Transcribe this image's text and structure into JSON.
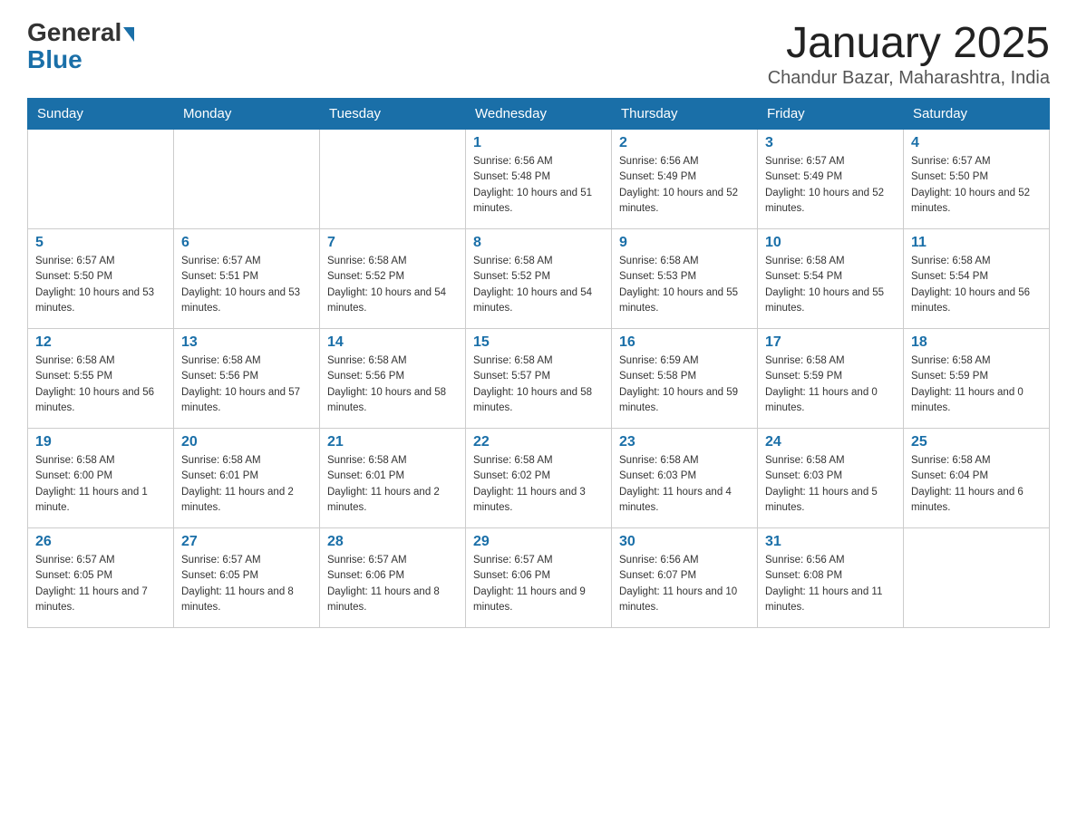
{
  "header": {
    "logo_general": "General",
    "logo_blue": "Blue",
    "month_year": "January 2025",
    "location": "Chandur Bazar, Maharashtra, India"
  },
  "weekdays": [
    "Sunday",
    "Monday",
    "Tuesday",
    "Wednesday",
    "Thursday",
    "Friday",
    "Saturday"
  ],
  "weeks": [
    [
      {
        "day": "",
        "info": ""
      },
      {
        "day": "",
        "info": ""
      },
      {
        "day": "",
        "info": ""
      },
      {
        "day": "1",
        "info": "Sunrise: 6:56 AM\nSunset: 5:48 PM\nDaylight: 10 hours and 51 minutes."
      },
      {
        "day": "2",
        "info": "Sunrise: 6:56 AM\nSunset: 5:49 PM\nDaylight: 10 hours and 52 minutes."
      },
      {
        "day": "3",
        "info": "Sunrise: 6:57 AM\nSunset: 5:49 PM\nDaylight: 10 hours and 52 minutes."
      },
      {
        "day": "4",
        "info": "Sunrise: 6:57 AM\nSunset: 5:50 PM\nDaylight: 10 hours and 52 minutes."
      }
    ],
    [
      {
        "day": "5",
        "info": "Sunrise: 6:57 AM\nSunset: 5:50 PM\nDaylight: 10 hours and 53 minutes."
      },
      {
        "day": "6",
        "info": "Sunrise: 6:57 AM\nSunset: 5:51 PM\nDaylight: 10 hours and 53 minutes."
      },
      {
        "day": "7",
        "info": "Sunrise: 6:58 AM\nSunset: 5:52 PM\nDaylight: 10 hours and 54 minutes."
      },
      {
        "day": "8",
        "info": "Sunrise: 6:58 AM\nSunset: 5:52 PM\nDaylight: 10 hours and 54 minutes."
      },
      {
        "day": "9",
        "info": "Sunrise: 6:58 AM\nSunset: 5:53 PM\nDaylight: 10 hours and 55 minutes."
      },
      {
        "day": "10",
        "info": "Sunrise: 6:58 AM\nSunset: 5:54 PM\nDaylight: 10 hours and 55 minutes."
      },
      {
        "day": "11",
        "info": "Sunrise: 6:58 AM\nSunset: 5:54 PM\nDaylight: 10 hours and 56 minutes."
      }
    ],
    [
      {
        "day": "12",
        "info": "Sunrise: 6:58 AM\nSunset: 5:55 PM\nDaylight: 10 hours and 56 minutes."
      },
      {
        "day": "13",
        "info": "Sunrise: 6:58 AM\nSunset: 5:56 PM\nDaylight: 10 hours and 57 minutes."
      },
      {
        "day": "14",
        "info": "Sunrise: 6:58 AM\nSunset: 5:56 PM\nDaylight: 10 hours and 58 minutes."
      },
      {
        "day": "15",
        "info": "Sunrise: 6:58 AM\nSunset: 5:57 PM\nDaylight: 10 hours and 58 minutes."
      },
      {
        "day": "16",
        "info": "Sunrise: 6:59 AM\nSunset: 5:58 PM\nDaylight: 10 hours and 59 minutes."
      },
      {
        "day": "17",
        "info": "Sunrise: 6:58 AM\nSunset: 5:59 PM\nDaylight: 11 hours and 0 minutes."
      },
      {
        "day": "18",
        "info": "Sunrise: 6:58 AM\nSunset: 5:59 PM\nDaylight: 11 hours and 0 minutes."
      }
    ],
    [
      {
        "day": "19",
        "info": "Sunrise: 6:58 AM\nSunset: 6:00 PM\nDaylight: 11 hours and 1 minute."
      },
      {
        "day": "20",
        "info": "Sunrise: 6:58 AM\nSunset: 6:01 PM\nDaylight: 11 hours and 2 minutes."
      },
      {
        "day": "21",
        "info": "Sunrise: 6:58 AM\nSunset: 6:01 PM\nDaylight: 11 hours and 2 minutes."
      },
      {
        "day": "22",
        "info": "Sunrise: 6:58 AM\nSunset: 6:02 PM\nDaylight: 11 hours and 3 minutes."
      },
      {
        "day": "23",
        "info": "Sunrise: 6:58 AM\nSunset: 6:03 PM\nDaylight: 11 hours and 4 minutes."
      },
      {
        "day": "24",
        "info": "Sunrise: 6:58 AM\nSunset: 6:03 PM\nDaylight: 11 hours and 5 minutes."
      },
      {
        "day": "25",
        "info": "Sunrise: 6:58 AM\nSunset: 6:04 PM\nDaylight: 11 hours and 6 minutes."
      }
    ],
    [
      {
        "day": "26",
        "info": "Sunrise: 6:57 AM\nSunset: 6:05 PM\nDaylight: 11 hours and 7 minutes."
      },
      {
        "day": "27",
        "info": "Sunrise: 6:57 AM\nSunset: 6:05 PM\nDaylight: 11 hours and 8 minutes."
      },
      {
        "day": "28",
        "info": "Sunrise: 6:57 AM\nSunset: 6:06 PM\nDaylight: 11 hours and 8 minutes."
      },
      {
        "day": "29",
        "info": "Sunrise: 6:57 AM\nSunset: 6:06 PM\nDaylight: 11 hours and 9 minutes."
      },
      {
        "day": "30",
        "info": "Sunrise: 6:56 AM\nSunset: 6:07 PM\nDaylight: 11 hours and 10 minutes."
      },
      {
        "day": "31",
        "info": "Sunrise: 6:56 AM\nSunset: 6:08 PM\nDaylight: 11 hours and 11 minutes."
      },
      {
        "day": "",
        "info": ""
      }
    ]
  ]
}
